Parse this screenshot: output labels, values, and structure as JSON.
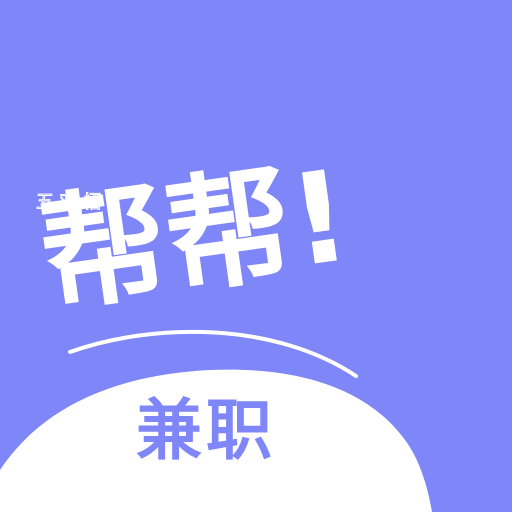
{
  "app_icon": {
    "title": "帮帮!",
    "subtitle": "兼职",
    "watermark": "五 欢 悟",
    "colors": {
      "background": "#7f86f7",
      "foreground": "#ffffff",
      "accent_text": "#7f86f7"
    }
  }
}
